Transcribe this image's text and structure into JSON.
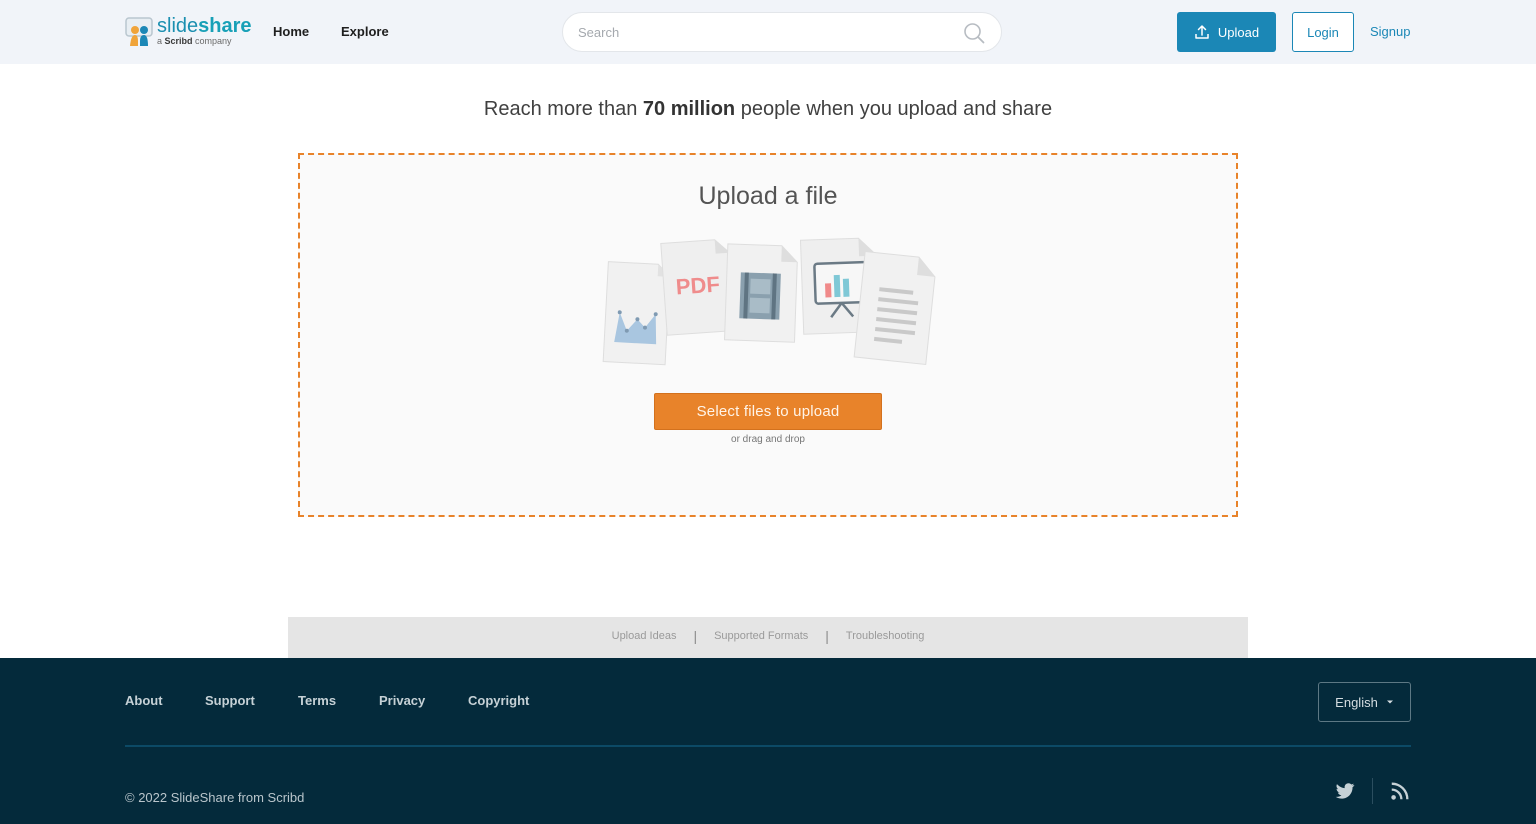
{
  "header": {
    "logo_word_light": "slide",
    "logo_word_bold": "share",
    "logo_sub_prefix": "a ",
    "logo_sub_brand": "Scribd",
    "logo_sub_suffix": " company",
    "nav": {
      "home": "Home",
      "explore": "Explore"
    },
    "search": {
      "placeholder": "Search",
      "value": ""
    },
    "upload_label": "Upload",
    "login_label": "Login",
    "signup_label": "Signup"
  },
  "hero": {
    "tagline_prefix": "Reach more than ",
    "tagline_bold": "70 million",
    "tagline_suffix": " people when you upload and share"
  },
  "dropzone": {
    "title": "Upload a file",
    "pdf_label": "PDF",
    "select_label": "Select files to upload",
    "drag_hint": "or drag and drop"
  },
  "helpbar": {
    "links": [
      "Upload Ideas",
      "Supported Formats",
      "Troubleshooting"
    ],
    "separator": "|"
  },
  "footer": {
    "links": [
      "About",
      "Support",
      "Terms",
      "Privacy",
      "Copyright"
    ],
    "language": "English",
    "copyright": "© 2022 SlideShare from Scribd",
    "social_icons": [
      "twitter-icon",
      "rss-icon"
    ]
  },
  "colors": {
    "brand_blue": "#1b87b6",
    "accent_orange": "#e8832a",
    "footer_bg": "#042a3b",
    "header_bg": "#f1f4f9"
  }
}
